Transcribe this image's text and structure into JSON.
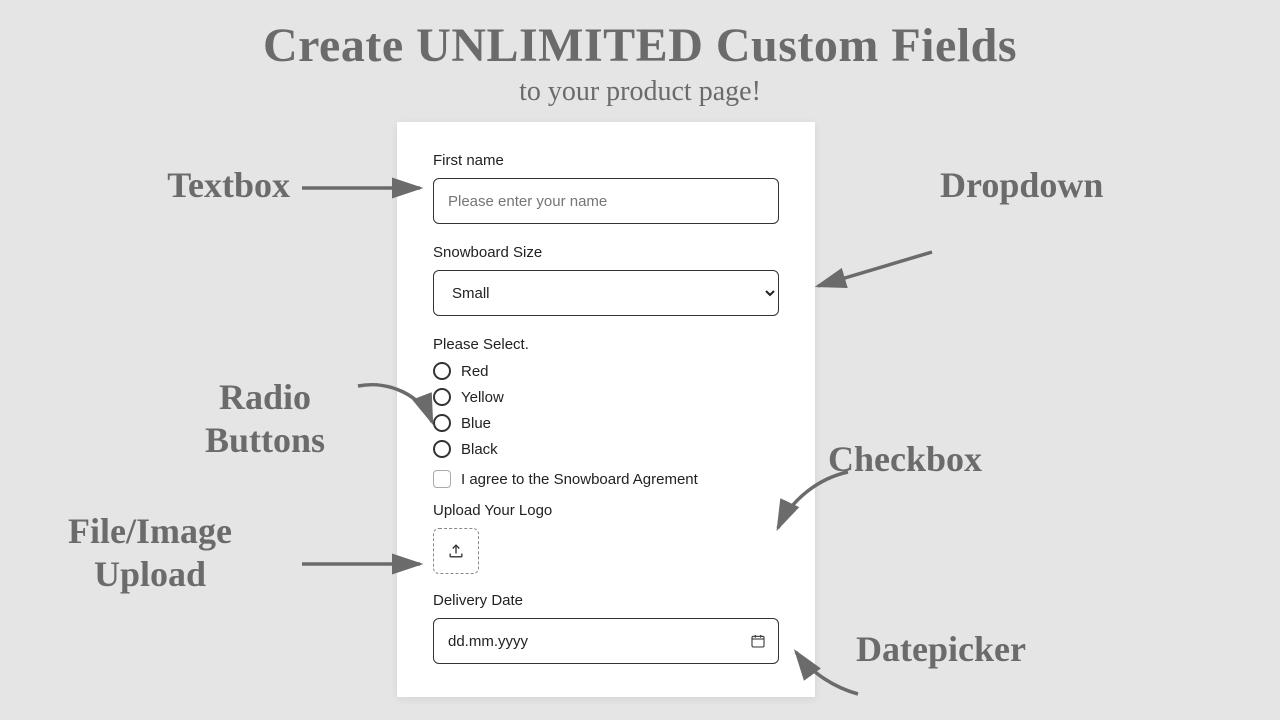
{
  "headline": "Create UNLIMITED Custom Fields",
  "subhead": "to your product page!",
  "annotations": {
    "textbox": "Textbox",
    "dropdown": "Dropdown",
    "radio_l1": "Radio",
    "radio_l2": "Buttons",
    "checkbox": "Checkbox",
    "upload_l1": "File/Image",
    "upload_l2": "Upload",
    "datepicker": "Datepicker"
  },
  "form": {
    "first_name_label": "First name",
    "first_name_placeholder": "Please enter your name",
    "size_label": "Snowboard Size",
    "size_selected": "Small",
    "radio_label": "Please Select.",
    "radio_options": {
      "r0": "Red",
      "r1": "Yellow",
      "r2": "Blue",
      "r3": "Black"
    },
    "agree_label": "I agree to the Snowboard Agrement",
    "upload_label": "Upload Your Logo",
    "date_label": "Delivery Date",
    "date_value": "dd.mm.yyyy"
  }
}
